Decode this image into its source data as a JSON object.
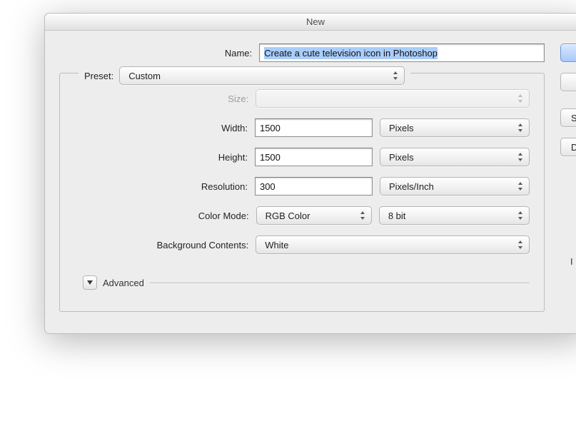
{
  "window": {
    "title": "New"
  },
  "name": {
    "label": "Name:",
    "value": "Create a cute television icon in Photoshop"
  },
  "preset": {
    "label": "Preset:",
    "value": "Custom"
  },
  "size": {
    "label": "Size:",
    "value": ""
  },
  "width": {
    "label": "Width:",
    "value": "1500",
    "units": "Pixels"
  },
  "height": {
    "label": "Height:",
    "value": "1500",
    "units": "Pixels"
  },
  "resolution": {
    "label": "Resolution:",
    "value": "300",
    "units": "Pixels/Inch"
  },
  "color_mode": {
    "label": "Color Mode:",
    "value": "RGB Color",
    "depth": "8 bit"
  },
  "background": {
    "label": "Background Contents:",
    "value": "White"
  },
  "advanced": {
    "label": "Advanced"
  },
  "right": {
    "primary": "",
    "second": "",
    "save": "Sav",
    "delete": "Del",
    "footer": "I"
  }
}
